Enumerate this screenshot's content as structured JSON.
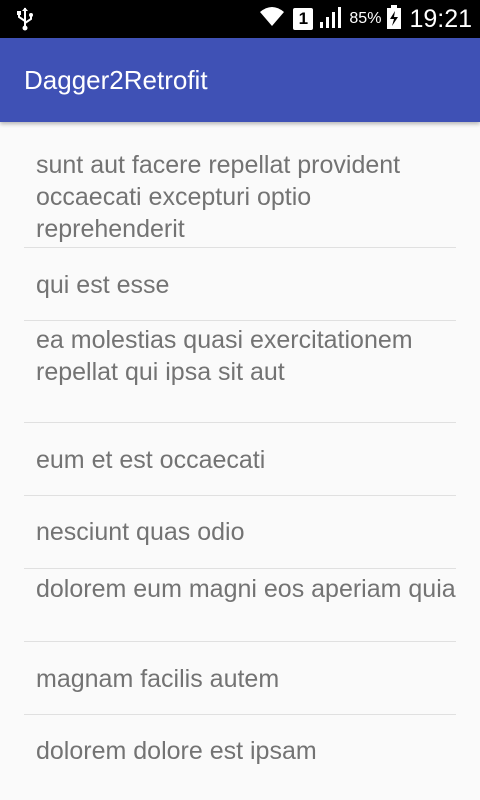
{
  "status_bar": {
    "usb_icon": "usb-icon",
    "wifi_icon": "wifi-icon",
    "sim_label": "1",
    "signal_icon": "signal-icon",
    "battery_percent": "85%",
    "battery_icon": "battery-charging-icon",
    "time": "19:21"
  },
  "app_bar": {
    "title": "Dagger2Retrofit",
    "color": "#3f51b5"
  },
  "list": {
    "items": [
      {
        "title": "sunt aut facere repellat provident occaecati excepturi optio reprehenderit"
      },
      {
        "title": "qui est esse"
      },
      {
        "title": "ea molestias quasi exercitationem repellat qui ipsa sit aut"
      },
      {
        "title": "eum et est occaecati"
      },
      {
        "title": "nesciunt quas odio"
      },
      {
        "title": "dolorem eum magni eos aperiam quia"
      },
      {
        "title": "magnam facilis autem"
      },
      {
        "title": "dolorem dolore est ipsam"
      }
    ]
  }
}
